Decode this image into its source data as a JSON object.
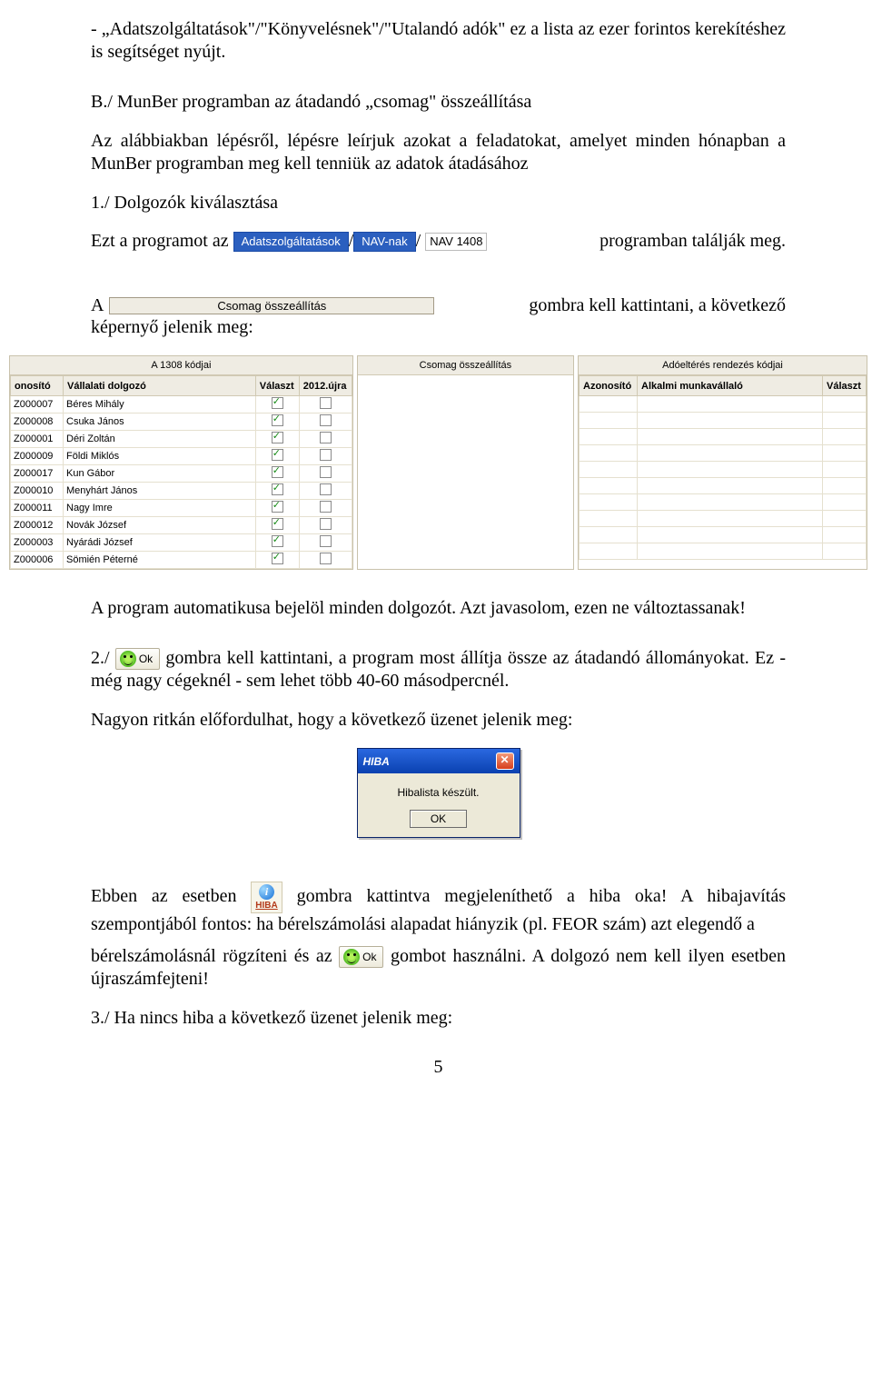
{
  "p1_bullet": "- „Adatszolgáltatások\"/\"Könyvelésnek\"/\"Utalandó adók\" ez a lista az ezer forintos kerekítéshez is segítséget nyújt.",
  "heading_b": "B./ MunBer programban az átadandó „csomag\" összeállítása",
  "p2": "Az alábbiakban lépésről, lépésre leírjuk azokat a feladatokat, amelyet minden hónapban a MunBer programban meg kell tenniük az adatok átadásához",
  "sec1_title": "1./ Dolgozók kiválasztása",
  "line1_a": "Ezt a programot az ",
  "btn_blue1": "Adatszolgáltatások",
  "btn_blue2": "NAV-nak",
  "nav1408": "NAV 1408",
  "line1_b": " programban találják meg.",
  "line2_a": "A ",
  "long_btn": "Csomag összeállítás",
  "line2_b": " gombra kell kattintani, a következő",
  "line2_c": "képernyő jelenik meg:",
  "panel1_top": "A 1308 kódjai",
  "panel1_cols": [
    "onosító",
    "Vállalati dolgozó",
    "Választ",
    "2012.újra"
  ],
  "panel1_rows": [
    [
      "Z000007",
      "Béres Mihály",
      true,
      false
    ],
    [
      "Z000008",
      "Csuka János",
      true,
      false
    ],
    [
      "Z000001",
      "Déri Zoltán",
      true,
      false
    ],
    [
      "Z000009",
      "Földi Miklós",
      true,
      false
    ],
    [
      "Z000017",
      "Kun Gábor",
      true,
      false
    ],
    [
      "Z000010",
      "Menyhárt János",
      true,
      false
    ],
    [
      "Z000011",
      "Nagy Imre",
      true,
      false
    ],
    [
      "Z000012",
      "Novák József",
      true,
      false
    ],
    [
      "Z000003",
      "Nyárádi József",
      true,
      false
    ],
    [
      "Z000006",
      "Sömién Péterné",
      true,
      false
    ]
  ],
  "panel2_top": "Csomag összeállítás",
  "panel3_top": "Adóeltérés rendezés kódjai",
  "panel3_cols": [
    "Azonosító",
    "Alkalmi munkavállaló",
    "Választ"
  ],
  "p_after_table": "A program automatikusa bejelöl minden dolgozót. Azt javasolom, ezen ne változtassanak!",
  "ok_label": "Ok",
  "line3_a": "2./ ",
  "line3_b": " gombra kell kattintani, a program most állítja össze az átadandó állományokat. Ez - még nagy cégeknél  - sem lehet több 40-60 másodpercnél.",
  "p_rare": "Nagyon ritkán előfordulhat, hogy a következő üzenet jelenik meg:",
  "hiba_title": "HIBA",
  "hiba_msg": "Hibalista készült.",
  "hiba_ok": "OK",
  "line4_a": "Ebben az esetben ",
  "info_label": "HIBA",
  "line4_b": " gombra kattintva megjeleníthető a hiba oka! A hibajavítás szempontjából fontos: ha bérelszámolási alapadat hiányzik (pl. FEOR szám) azt elegendő a",
  "line5_a": "bérelszámolásnál rögzíteni és az ",
  "line5_b": " gombot használni. A dolgozó nem kell ilyen esetben újraszámfejteni!",
  "sec3": "3./ Ha nincs hiba a következő üzenet jelenik meg:",
  "pagenum": "5"
}
